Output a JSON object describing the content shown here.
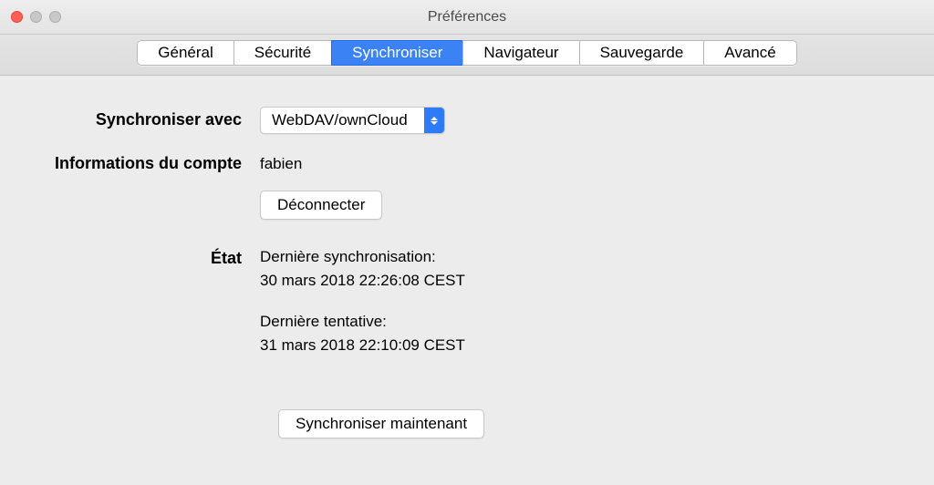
{
  "window": {
    "title": "Préférences"
  },
  "tabs": [
    {
      "label": "Général",
      "active": false
    },
    {
      "label": "Sécurité",
      "active": false
    },
    {
      "label": "Synchroniser",
      "active": true
    },
    {
      "label": "Navigateur",
      "active": false
    },
    {
      "label": "Sauvegarde",
      "active": false
    },
    {
      "label": "Avancé",
      "active": false
    }
  ],
  "form": {
    "sync_with_label": "Synchroniser avec",
    "sync_with_value": "WebDAV/ownCloud",
    "account_label": "Informations du compte",
    "account_value": "fabien",
    "disconnect_button": "Déconnecter",
    "status_label": "État",
    "last_sync_label": "Dernière synchronisation:",
    "last_sync_value": "30 mars 2018 22:26:08 CEST",
    "last_attempt_label": "Dernière tentative:",
    "last_attempt_value": "31 mars 2018 22:10:09 CEST",
    "sync_now_button": "Synchroniser maintenant"
  }
}
